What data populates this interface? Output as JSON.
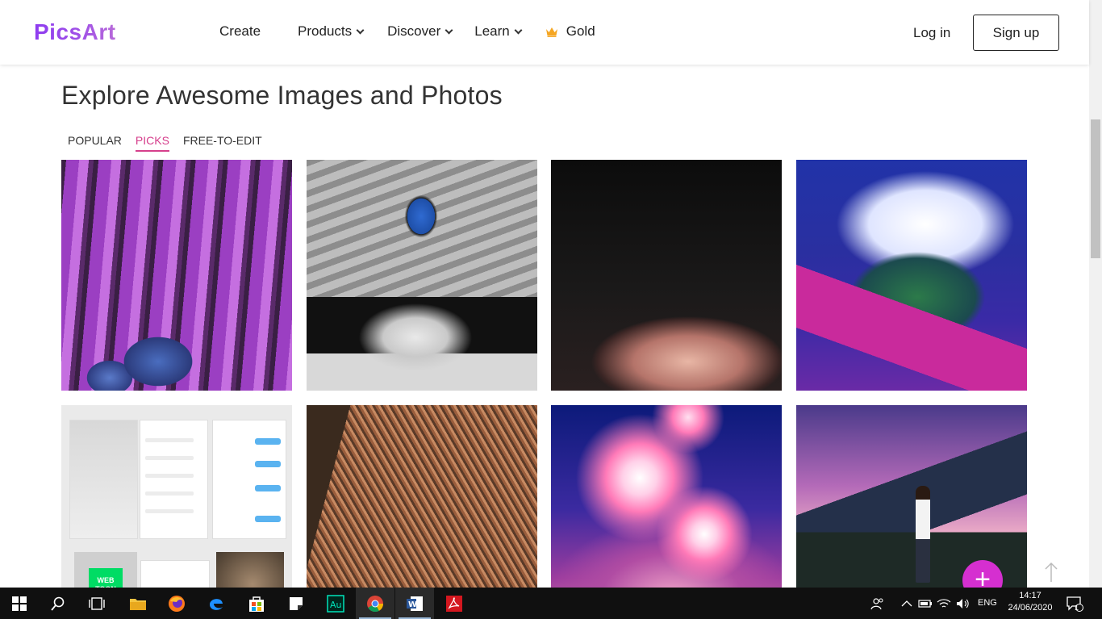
{
  "header": {
    "logo": "PicsArt",
    "nav": {
      "create": "Create",
      "products": "Products",
      "discover": "Discover",
      "learn": "Learn",
      "gold": "Gold"
    },
    "login": "Log in",
    "signup": "Sign up"
  },
  "main": {
    "title": "Explore Awesome Images and Photos",
    "tabs": [
      {
        "label": "POPULAR",
        "active": false
      },
      {
        "label": "PICKS",
        "active": true
      },
      {
        "label": "FREE-TO-EDIT",
        "active": false
      }
    ],
    "tiles": [
      {
        "description": "purple forest with mushrooms"
      },
      {
        "description": "black and white collage woman"
      },
      {
        "description": "dark portrait face closeup"
      },
      {
        "description": "blue forest path"
      },
      {
        "description": "chat app screenshots collage"
      },
      {
        "description": "orange dried plant"
      },
      {
        "description": "neon stars crowd silhouette"
      },
      {
        "description": "man on mountain balcony"
      }
    ],
    "webtoon_label": "WEB TOON"
  },
  "floating": {
    "fab_symbol": "+",
    "scroll_top_icon": "arrow-up-icon"
  },
  "taskbar": {
    "language": "ENG",
    "time": "14:17",
    "date": "24/06/2020",
    "notification_count": "1",
    "apps": [
      "windows-start-icon",
      "search-icon",
      "task-view-icon",
      "file-explorer-icon",
      "firefox-icon",
      "edge-icon",
      "store-icon",
      "sticky-notes-icon",
      "audition-icon",
      "chrome-icon",
      "word-icon",
      "acrobat-icon"
    ]
  },
  "colors": {
    "accent_pink": "#d63f8c",
    "fab": "#d52fd0",
    "logo_purple": "#8e3cf0"
  }
}
